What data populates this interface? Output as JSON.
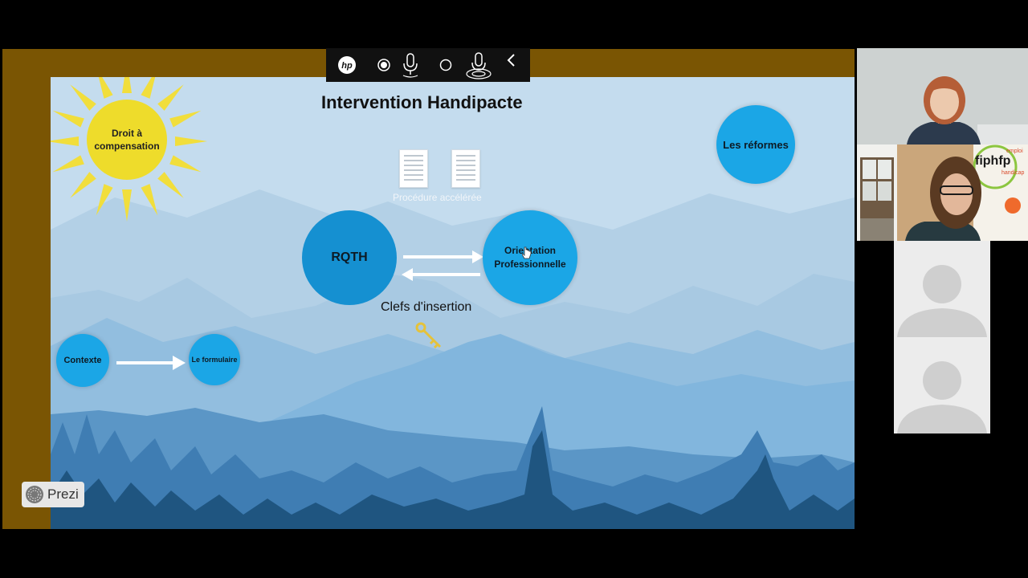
{
  "toolbar": {
    "logo_text": "hp",
    "icons": [
      "record-dot-icon",
      "microphone-icon",
      "circle-outline-icon",
      "microphone-broadcast-icon",
      "chevron-left-icon"
    ]
  },
  "slide": {
    "title": "Intervention Handipacte",
    "sun_label_line1": "Droit à",
    "sun_label_line2": "compensation",
    "reformes": "Les réformes",
    "rqth": "RQTH",
    "orientation_line1": "Orientation",
    "orientation_line2": "Professionnelle",
    "procedure": "Procédure accélérée",
    "clefs": "Clefs d'insertion",
    "contexte": "Contexte",
    "formulaire": "Le formulaire"
  },
  "badge": {
    "label": "Prezi"
  },
  "participants": {
    "logo_main": "fiphfp",
    "logo_top": "emploi",
    "logo_bottom": "handicap"
  },
  "colors": {
    "accent_blue": "#1ba6e6",
    "sun_yellow": "#eedc2b",
    "frame_brown": "#7a5503"
  }
}
